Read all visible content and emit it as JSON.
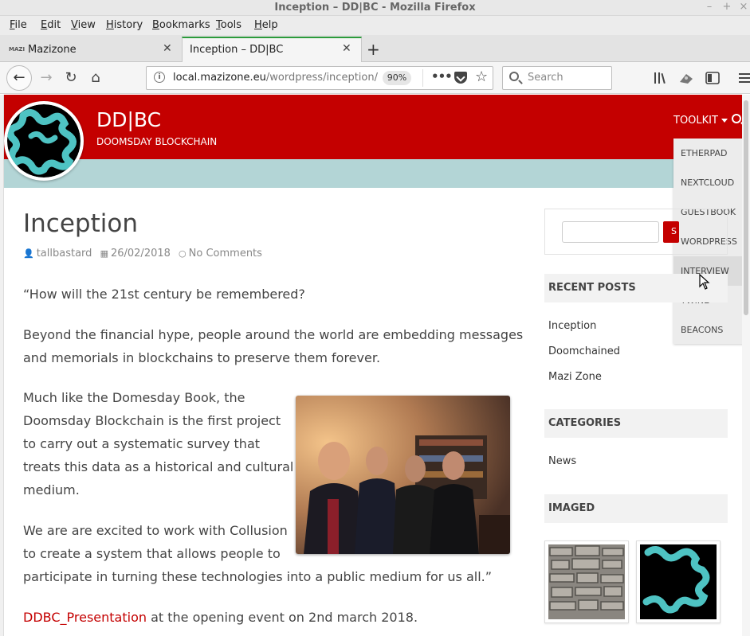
{
  "window": {
    "title": "Inception – DD|BC - Mozilla Firefox",
    "controls": [
      "–",
      "+",
      "×"
    ]
  },
  "menu": [
    "File",
    "Edit",
    "View",
    "History",
    "Bookmarks",
    "Tools",
    "Help"
  ],
  "tabs": [
    {
      "label": "Mazizone",
      "favicon_text": "MAZI",
      "active": false
    },
    {
      "label": "Inception – DD|BC",
      "active": true
    }
  ],
  "nav": {
    "url_host": "local.mazizone.eu",
    "url_path": "/wordpress/inception/",
    "zoom": "90%",
    "search_placeholder": "Search"
  },
  "site": {
    "title": "DD|BC",
    "tagline": "DOOMSDAY BLOCKCHAIN",
    "menu_label": "TOOLKIT",
    "dropdown": [
      "ETHERPAD",
      "NEXTCLOUD",
      "GUESTBOOK",
      "WORDPRESS",
      "INTERVIEW",
      "TWINE",
      "BEACONS"
    ],
    "dropdown_hover": "INTERVIEW"
  },
  "post": {
    "title": "Inception",
    "author": "tallbastard",
    "date": "26/02/2018",
    "comments": "No Comments",
    "p1": "“How will the 21st century be remembered?",
    "p2_l1": "Beyond the financial hype, people around the world are embedding messages",
    "p2_l2": "and memorials in blockchains to preserve them forever.",
    "p3_l1": "Much like the Domesday Book, the",
    "p3_l2": "Doomsday Blockchain is the first project",
    "p3_l3": "to carry out a systematic survey that",
    "p3_l4": "treats this data as a historical and cultural",
    "p3_l5": "medium.",
    "p4_l1": "We are are excited to work with Collusion",
    "p4_l2": "to create a system that allows people to",
    "p4_l3": "participate in turning these technologies into a public medium for us all.”",
    "link": "DDBC_Presentation",
    "p5_rest": " at the opening event on 2nd march 2018."
  },
  "sidebar": {
    "search_button": "S",
    "recent_heading": "RECENT POSTS",
    "recent": [
      "Inception",
      "Doomchained",
      "Mazi Zone"
    ],
    "categories_heading": "CATEGORIES",
    "categories": [
      "News"
    ],
    "imaged_heading": "IMAGED"
  },
  "colors": {
    "brand_red": "#c40000",
    "subbar_teal": "#b3d5d6",
    "tab_accent": "#2b9b3b"
  }
}
